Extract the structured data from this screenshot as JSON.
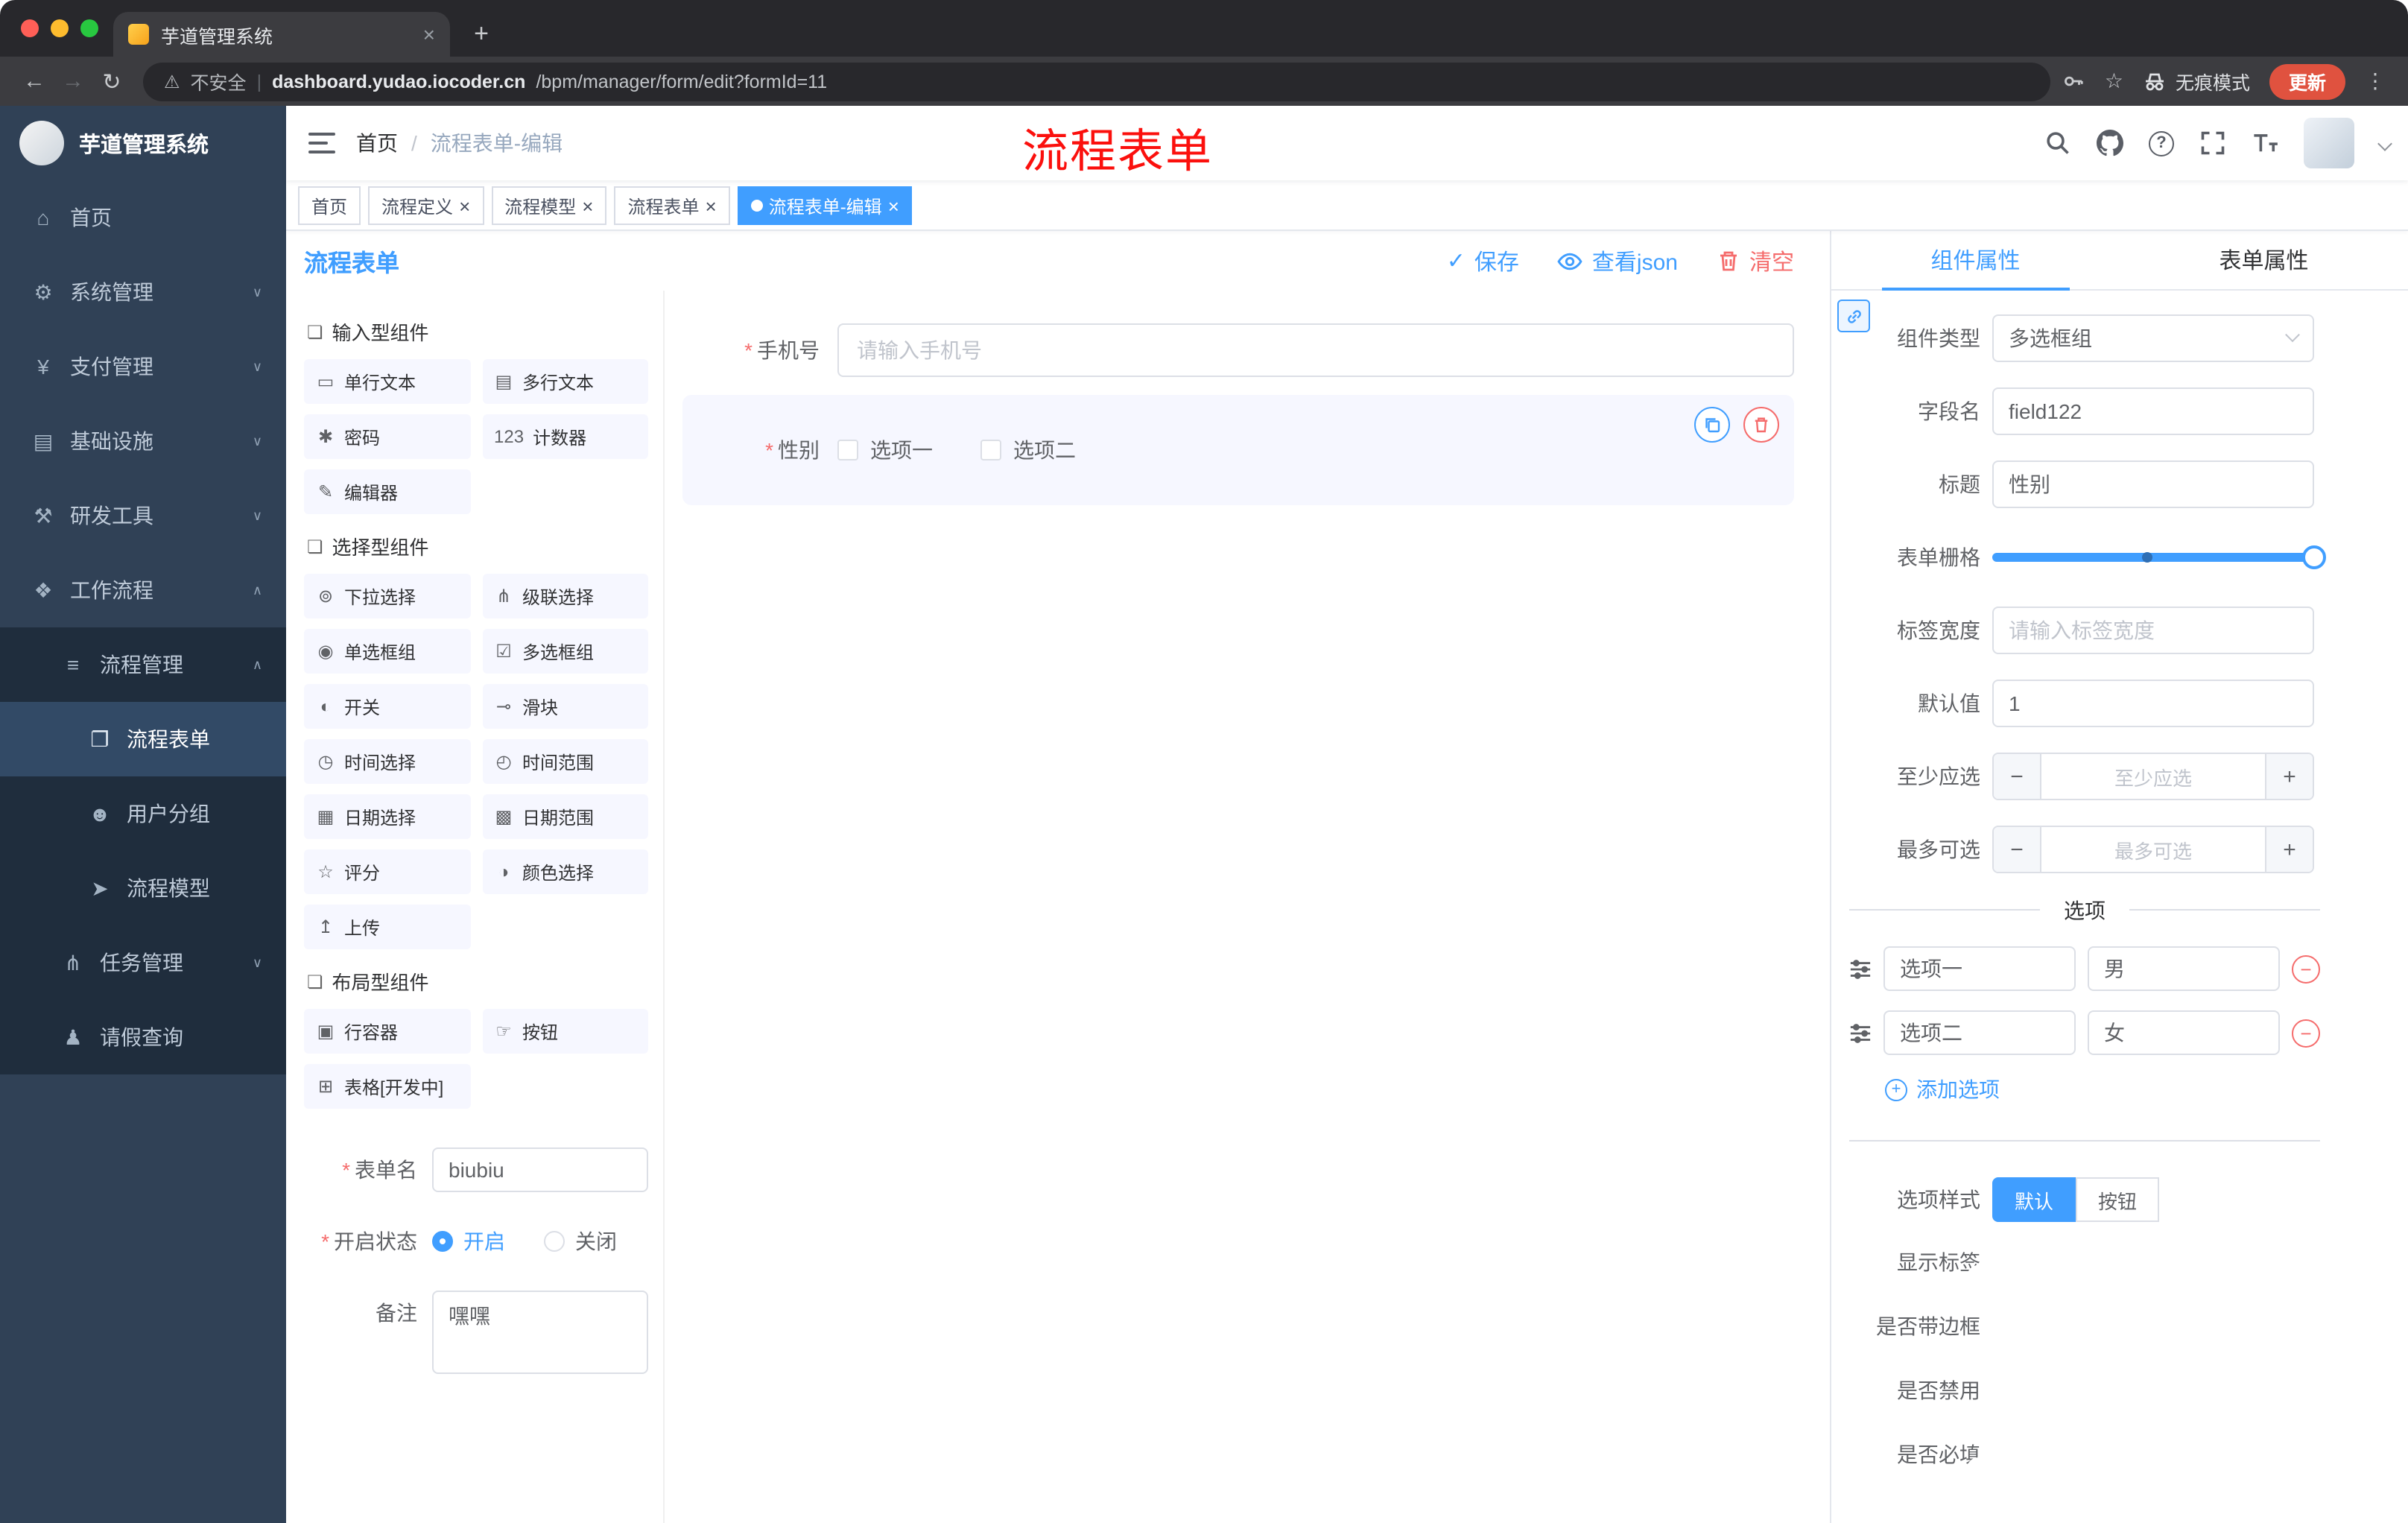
{
  "ui": {
    "close": "×",
    "plus": "+",
    "minus": "−",
    "kebab": "⋮",
    "check": "✓",
    "question": "?",
    "star": "☆",
    "back": "←",
    "forward": "→",
    "reload": "↻",
    "warning": "⚠",
    "pipe": "|",
    "new_tab": "+",
    "required": "*"
  },
  "browser": {
    "tab_title": "芋道管理系统",
    "toolbar": {
      "security": "不安全",
      "url_domain": "dashboard.yudao.iocoder.cn",
      "url_path": "/bpm/manager/form/edit?formId=11",
      "incognito": "无痕模式",
      "update": "更新"
    }
  },
  "app": {
    "sidebar": {
      "logo": "芋道管理系统",
      "menu": [
        {
          "label": "首页",
          "icon_name": "home-icon",
          "glyph": "⌂",
          "level": 1,
          "chevron": ""
        },
        {
          "label": "系统管理",
          "icon_name": "gear-icon",
          "glyph": "⚙",
          "level": 1,
          "chevron": "∨"
        },
        {
          "label": "支付管理",
          "icon_name": "payment-icon",
          "glyph": "¥",
          "level": 1,
          "chevron": "∨"
        },
        {
          "label": "基础设施",
          "icon_name": "infrastructure-icon",
          "glyph": "▤",
          "level": 1,
          "chevron": "∨"
        },
        {
          "label": "研发工具",
          "icon_name": "devtools-icon",
          "glyph": "⚒",
          "level": 1,
          "chevron": "∨"
        },
        {
          "label": "工作流程",
          "icon_name": "workflow-icon",
          "glyph": "❖",
          "level": 1,
          "chevron": "∧"
        },
        {
          "label": "流程管理",
          "icon_name": "process-management-icon",
          "glyph": "≡",
          "level": 2,
          "chevron": "∧",
          "dark": true
        },
        {
          "label": "流程表单",
          "icon_name": "process-form-icon",
          "glyph": "❐",
          "level": 3,
          "chevron": "",
          "dark": true,
          "active": true
        },
        {
          "label": "用户分组",
          "icon_name": "user-group-icon",
          "glyph": "☻",
          "level": 3,
          "chevron": "",
          "dark": true
        },
        {
          "label": "流程模型",
          "icon_name": "process-model-icon",
          "glyph": "➤",
          "level": 3,
          "chevron": "",
          "dark": true
        },
        {
          "label": "任务管理",
          "icon_name": "task-management-icon",
          "glyph": "⋔",
          "level": 2,
          "chevron": "∨",
          "dark": true
        },
        {
          "label": "请假查询",
          "icon_name": "leave-query-icon",
          "glyph": "♟",
          "level": 2,
          "chevron": "",
          "dark": true
        }
      ]
    },
    "header": {
      "breadcrumb_home": "首页",
      "breadcrumb_sep": "/",
      "breadcrumb_current": "流程表单-编辑",
      "annotation": "流程表单"
    },
    "tags": [
      {
        "label": "首页",
        "closable": false,
        "active": false
      },
      {
        "label": "流程定义",
        "closable": true,
        "active": false
      },
      {
        "label": "流程模型",
        "closable": true,
        "active": false
      },
      {
        "label": "流程表单",
        "closable": true,
        "active": false
      },
      {
        "label": "流程表单-编辑",
        "closable": true,
        "active": true
      }
    ]
  },
  "editor": {
    "title": "流程表单",
    "actions": {
      "save": "保存",
      "view_json": "查看json",
      "clear": "清空"
    },
    "palette": {
      "groups": [
        {
          "title": "输入型组件",
          "items": [
            {
              "label": "单行文本",
              "icon_name": "single-line-text-icon",
              "glyph": "▭"
            },
            {
              "label": "多行文本",
              "icon_name": "multi-line-text-icon",
              "glyph": "▤"
            },
            {
              "label": "密码",
              "icon_name": "password-icon",
              "glyph": "✱"
            },
            {
              "label": "计数器",
              "icon_name": "counter-icon",
              "glyph": "123"
            },
            {
              "label": "编辑器",
              "icon_name": "rich-editor-icon",
              "glyph": "✎"
            }
          ]
        },
        {
          "title": "选择型组件",
          "items": [
            {
              "label": "下拉选择",
              "icon_name": "select-icon",
              "glyph": "⊚"
            },
            {
              "label": "级联选择",
              "icon_name": "cascader-icon",
              "glyph": "⋔"
            },
            {
              "label": "单选框组",
              "icon_name": "radio-group-icon",
              "glyph": "◉"
            },
            {
              "label": "多选框组",
              "icon_name": "checkbox-group-icon",
              "glyph": "☑"
            },
            {
              "label": "开关",
              "icon_name": "switch-icon",
              "glyph": "◐"
            },
            {
              "label": "滑块",
              "icon_name": "slider-icon",
              "glyph": "⊸"
            },
            {
              "label": "时间选择",
              "icon_name": "time-picker-icon",
              "glyph": "◷"
            },
            {
              "label": "时间范围",
              "icon_name": "time-range-icon",
              "glyph": "◴"
            },
            {
              "label": "日期选择",
              "icon_name": "date-picker-icon",
              "glyph": "▦"
            },
            {
              "label": "日期范围",
              "icon_name": "date-range-icon",
              "glyph": "▩"
            },
            {
              "label": "评分",
              "icon_name": "rate-icon",
              "glyph": "☆"
            },
            {
              "label": "颜色选择",
              "icon_name": "color-picker-icon",
              "glyph": "◑"
            },
            {
              "label": "上传",
              "icon_name": "upload-icon",
              "glyph": "↥"
            }
          ]
        },
        {
          "title": "布局型组件",
          "items": [
            {
              "label": "行容器",
              "icon_name": "row-container-icon",
              "glyph": "▣"
            },
            {
              "label": "按钮",
              "icon_name": "button-icon",
              "glyph": "☞"
            },
            {
              "label": "表格[开发中]",
              "icon_name": "table-icon",
              "glyph": "⊞"
            }
          ]
        }
      ]
    },
    "meta": {
      "name_label": "表单名",
      "name_value": "biubiu",
      "status_label": "开启状态",
      "status_options": [
        {
          "label": "开启",
          "checked": true
        },
        {
          "label": "关闭",
          "checked": false
        }
      ],
      "remark_label": "备注",
      "remark_value": "嘿嘿"
    },
    "canvas": {
      "phone": {
        "label": "手机号",
        "placeholder": "请输入手机号"
      },
      "gender": {
        "label": "性别",
        "options": [
          "选项一",
          "选项二"
        ]
      }
    }
  },
  "props": {
    "tabs": [
      {
        "label": "组件属性",
        "active": true
      },
      {
        "label": "表单属性",
        "active": false
      }
    ],
    "rows": {
      "component_type_label": "组件类型",
      "component_type_value": "多选框组",
      "field_name_label": "字段名",
      "field_name_value": "field122",
      "title_label": "标题",
      "title_value": "性别",
      "grid_label": "表单栅格",
      "label_width_label": "标签宽度",
      "label_width_placeholder": "请输入标签宽度",
      "default_label": "默认值",
      "default_value": "1",
      "min_label": "至少应选",
      "min_placeholder": "至少应选",
      "max_label": "最多可选",
      "max_placeholder": "最多可选"
    },
    "options_section": {
      "divider_label": "选项",
      "items": [
        {
          "label": "选项一",
          "value": "男"
        },
        {
          "label": "选项二",
          "value": "女"
        }
      ],
      "add_label": "添加选项"
    },
    "style_section": {
      "label": "选项样式",
      "buttons": [
        {
          "label": "默认",
          "active": true
        },
        {
          "label": "按钮",
          "active": false
        }
      ]
    },
    "switches": [
      {
        "label": "显示标签",
        "on": true
      },
      {
        "label": "是否带边框",
        "on": false
      },
      {
        "label": "是否禁用",
        "on": false
      },
      {
        "label": "是否必填",
        "on": true
      }
    ]
  }
}
